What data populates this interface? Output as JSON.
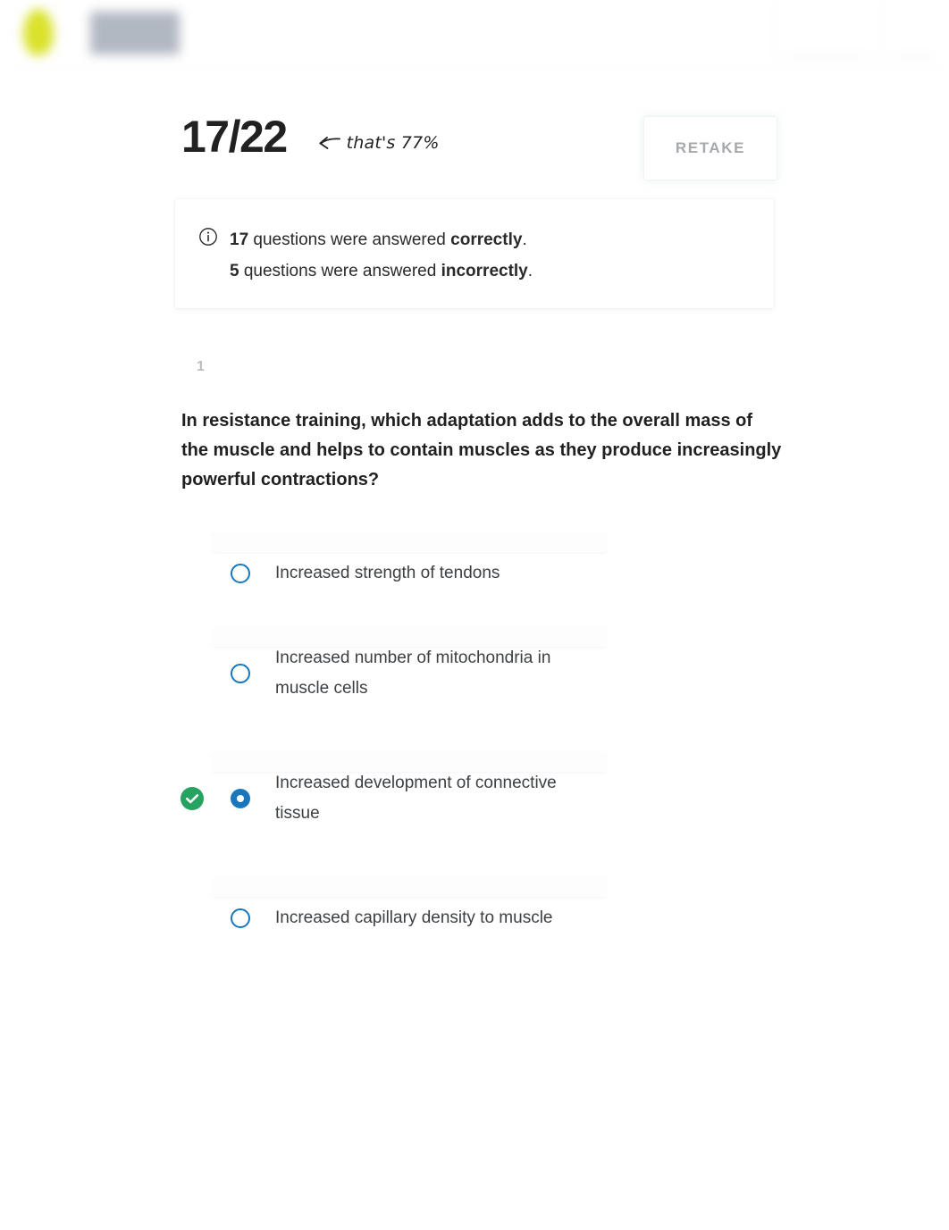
{
  "topbar": {
    "logo_mark": "leaf-logo-icon",
    "logo_text_redacted": "",
    "blurred": true
  },
  "score": {
    "value": "17/22",
    "annotation_arrow_icon": "arrow-left-icon",
    "annotation_text": "that's 77%",
    "percent": 77,
    "correct": 17,
    "total": 22
  },
  "retake": {
    "label": "RETAKE"
  },
  "summary": {
    "icon": "info-circle-icon",
    "correct_count": "17",
    "correct_text_before": " questions were answered ",
    "correct_word": "correctly",
    "correct_period": ".",
    "incorrect_count": "5",
    "incorrect_text_before": " questions were answered ",
    "incorrect_word": "incorrectly",
    "incorrect_period": "."
  },
  "question": {
    "number": "1",
    "text": "In resistance training, which adaptation adds to the overall mass of the muscle and helps to contain muscles as they produce increasingly powerful contractions?",
    "options": [
      {
        "label": "Increased strength of tendons",
        "selected": false,
        "correct": false
      },
      {
        "label": "Increased number of mitochondria in muscle cells",
        "selected": false,
        "correct": false
      },
      {
        "label": "Increased development of connective tissue",
        "selected": true,
        "correct": true
      },
      {
        "label": "Increased capillary density to muscle",
        "selected": false,
        "correct": false
      }
    ]
  },
  "colors": {
    "accent_blue": "#1b77bd",
    "success_green": "#27a361",
    "text_primary": "#1e2022",
    "text_secondary": "#3c4043",
    "muted": "#bdbdbd",
    "retake_text": "#a6a9ab",
    "logo_yellow": "#d8e020"
  }
}
